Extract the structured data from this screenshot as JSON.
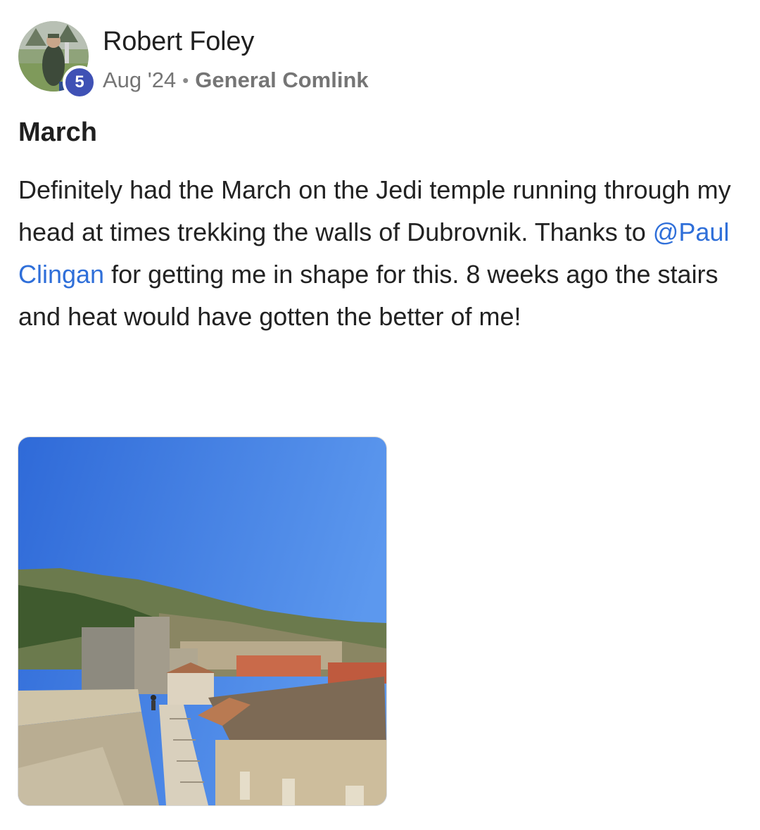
{
  "post": {
    "author": "Robert Foley",
    "level": "5",
    "date": "Aug '24",
    "separator": "•",
    "category": "General Comlink",
    "title": "March",
    "body_before": "Definitely had the March on the Jedi temple running through my head at times trekking the walls of Dubrovnik. Thanks to ",
    "mention": "@Paul Clingan",
    "body_after": " for getting me in shape for this. 8 weeks ago the stairs and heat would have gotten the better of me!"
  },
  "colors": {
    "badge": "#3f51b5",
    "mention": "#2f6fd9",
    "meta_text": "#757575"
  }
}
